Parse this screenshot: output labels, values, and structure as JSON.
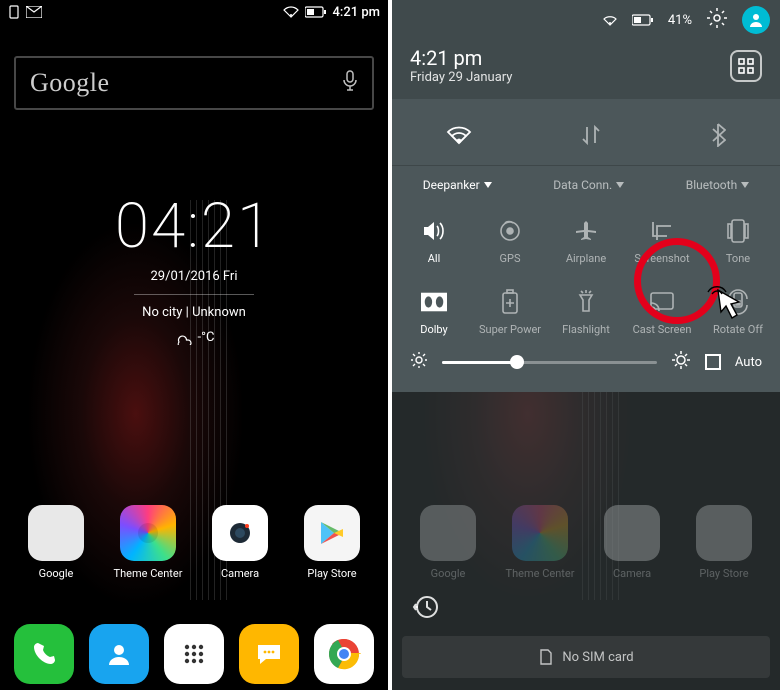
{
  "left": {
    "status": {
      "time": "4:21 pm"
    },
    "search": {
      "label": "Google"
    },
    "clock": {
      "time": "04:21",
      "date": "29/01/2016  Fri",
      "location": "No city | Unknown",
      "weather": "-°C"
    },
    "apps": [
      {
        "label": "Google"
      },
      {
        "label": "Theme Center"
      },
      {
        "label": "Camera"
      },
      {
        "label": "Play Store"
      }
    ]
  },
  "right": {
    "status": {
      "battery": "41%"
    },
    "panel": {
      "time": "4:21 pm",
      "date": "Friday 29 January",
      "network": {
        "wifi": "Deepanker",
        "data": "Data Conn.",
        "bt": "Bluetooth"
      },
      "tiles1": [
        {
          "label": "All"
        },
        {
          "label": "GPS"
        },
        {
          "label": "Airplane"
        },
        {
          "label": "Screenshot"
        },
        {
          "label": "Tone"
        }
      ],
      "tiles2": [
        {
          "label": "Dolby"
        },
        {
          "label": "Super Power"
        },
        {
          "label": "Flashlight"
        },
        {
          "label": "Cast Screen"
        },
        {
          "label": "Rotate Off"
        }
      ],
      "brightness": {
        "auto": "Auto"
      }
    },
    "nosim": "No SIM card",
    "apps": [
      {
        "label": "Google"
      },
      {
        "label": "Theme Center"
      },
      {
        "label": "Camera"
      },
      {
        "label": "Play Store"
      }
    ]
  }
}
